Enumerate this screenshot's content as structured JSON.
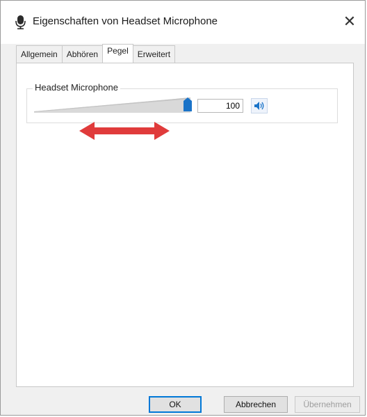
{
  "window": {
    "title": "Eigenschaften von Headset Microphone",
    "icon": "microphone-icon",
    "close_label": "✕"
  },
  "tabs": [
    {
      "label": "Allgemein",
      "active": false
    },
    {
      "label": "Abhören",
      "active": false
    },
    {
      "label": "Pegel",
      "active": true
    },
    {
      "label": "Erweitert",
      "active": false
    }
  ],
  "levels": {
    "group_label": "Headset Microphone",
    "value": "100",
    "slider_level": 1.0,
    "speaker_icon": "speaker-icon"
  },
  "annotation": {
    "icon": "double-arrow-icon",
    "color": "#e03b3b"
  },
  "buttons": {
    "ok": "OK",
    "cancel": "Abbrechen",
    "apply": "Übernehmen"
  }
}
